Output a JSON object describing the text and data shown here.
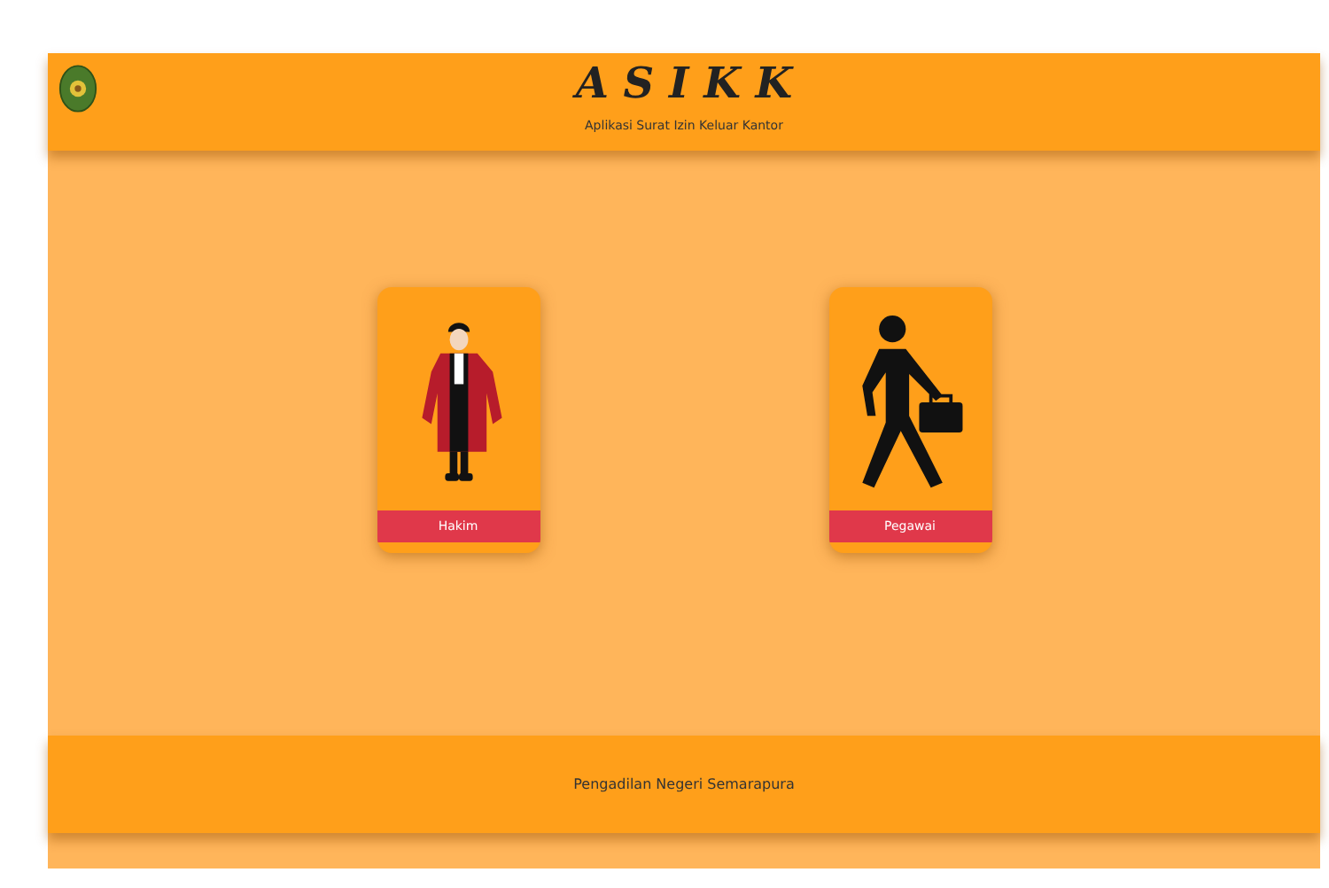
{
  "header": {
    "title": "A S I K K",
    "subtitle": "Aplikasi Surat Izin Keluar Kantor"
  },
  "cards": [
    {
      "kind": "judge",
      "label": "Hakim"
    },
    {
      "kind": "worker",
      "label": "Pegawai"
    }
  ],
  "footer": {
    "text": "Pengadilan Negeri Semarapura"
  }
}
